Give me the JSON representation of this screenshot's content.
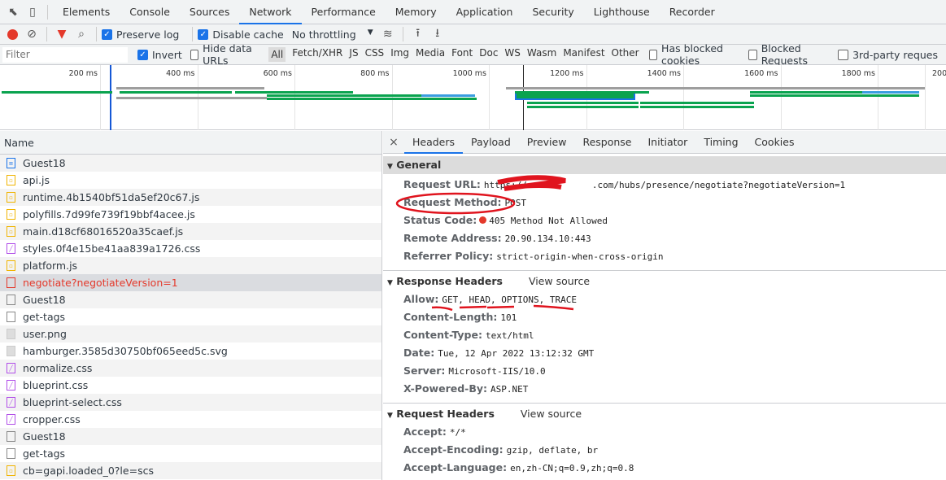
{
  "tabs": {
    "items": [
      "Elements",
      "Console",
      "Sources",
      "Network",
      "Performance",
      "Memory",
      "Application",
      "Security",
      "Lighthouse",
      "Recorder"
    ],
    "active": "Network"
  },
  "toolbar": {
    "preserve_log": "Preserve log",
    "preserve_log_checked": true,
    "disable_cache": "Disable cache",
    "disable_cache_checked": true,
    "throttling": "No throttling"
  },
  "filters": {
    "placeholder": "Filter",
    "invert": "Invert",
    "invert_checked": true,
    "hide_data_urls": "Hide data URLs",
    "types": [
      "All",
      "Fetch/XHR",
      "JS",
      "CSS",
      "Img",
      "Media",
      "Font",
      "Doc",
      "WS",
      "Wasm",
      "Manifest",
      "Other"
    ],
    "active_type": "All",
    "has_blocked_cookies": "Has blocked cookies",
    "blocked_requests": "Blocked Requests",
    "third_party": "3rd-party reques"
  },
  "overview": {
    "ticks": [
      "200 ms",
      "400 ms",
      "600 ms",
      "800 ms",
      "1000 ms",
      "1200 ms",
      "1400 ms",
      "1600 ms",
      "1800 ms",
      "200"
    ]
  },
  "requests": {
    "header": "Name",
    "items": [
      {
        "name": "Guest18",
        "type": "doc"
      },
      {
        "name": "api.js",
        "type": "js"
      },
      {
        "name": "runtime.4b1540bf51da5ef20c67.js",
        "type": "js"
      },
      {
        "name": "polyfills.7d99fe739f19bbf4acee.js",
        "type": "js"
      },
      {
        "name": "main.d18cf68016520a35caef.js",
        "type": "js"
      },
      {
        "name": "styles.0f4e15be41aa839a1726.css",
        "type": "css"
      },
      {
        "name": "platform.js",
        "type": "js"
      },
      {
        "name": "negotiate?negotiateVersion=1",
        "type": "err",
        "selected": true
      },
      {
        "name": "Guest18",
        "type": "other"
      },
      {
        "name": "get-tags",
        "type": "other"
      },
      {
        "name": "user.png",
        "type": "img"
      },
      {
        "name": "hamburger.3585d30750bf065eed5c.svg",
        "type": "img"
      },
      {
        "name": "normalize.css",
        "type": "css"
      },
      {
        "name": "blueprint.css",
        "type": "css"
      },
      {
        "name": "blueprint-select.css",
        "type": "css"
      },
      {
        "name": "cropper.css",
        "type": "css"
      },
      {
        "name": "Guest18",
        "type": "other"
      },
      {
        "name": "get-tags",
        "type": "other"
      },
      {
        "name": "cb=gapi.loaded_0?le=scs",
        "type": "js"
      }
    ]
  },
  "details": {
    "tabs": [
      "Headers",
      "Payload",
      "Preview",
      "Response",
      "Initiator",
      "Timing",
      "Cookies"
    ],
    "active": "Headers",
    "general": {
      "title": "General",
      "url_label": "Request URL:",
      "url_prefix": "https://",
      "url_suffix": ".com/hubs/presence/negotiate?negotiateVersion=1",
      "method_label": "Request Method:",
      "method": "POST",
      "status_label": "Status Code:",
      "status": "405 Method Not Allowed",
      "remote_label": "Remote Address:",
      "remote": "20.90.134.10:443",
      "referrer_label": "Referrer Policy:",
      "referrer": "strict-origin-when-cross-origin"
    },
    "response": {
      "title": "Response Headers",
      "view_source": "View source",
      "headers": [
        {
          "k": "Allow:",
          "v": "GET, HEAD, OPTIONS, TRACE"
        },
        {
          "k": "Content-Length:",
          "v": "101"
        },
        {
          "k": "Content-Type:",
          "v": "text/html"
        },
        {
          "k": "Date:",
          "v": "Tue, 12 Apr 2022 13:12:32 GMT"
        },
        {
          "k": "Server:",
          "v": "Microsoft-IIS/10.0"
        },
        {
          "k": "X-Powered-By:",
          "v": "ASP.NET"
        }
      ]
    },
    "request": {
      "title": "Request Headers",
      "view_source": "View source",
      "headers": [
        {
          "k": "Accept:",
          "v": "*/*"
        },
        {
          "k": "Accept-Encoding:",
          "v": "gzip, deflate, br"
        },
        {
          "k": "Accept-Language:",
          "v": "en,zh-CN;q=0.9,zh;q=0.8"
        }
      ]
    }
  },
  "colors": {
    "accent": "#1a73e8",
    "error": "#e4392b",
    "annotation": "#e0141e"
  }
}
